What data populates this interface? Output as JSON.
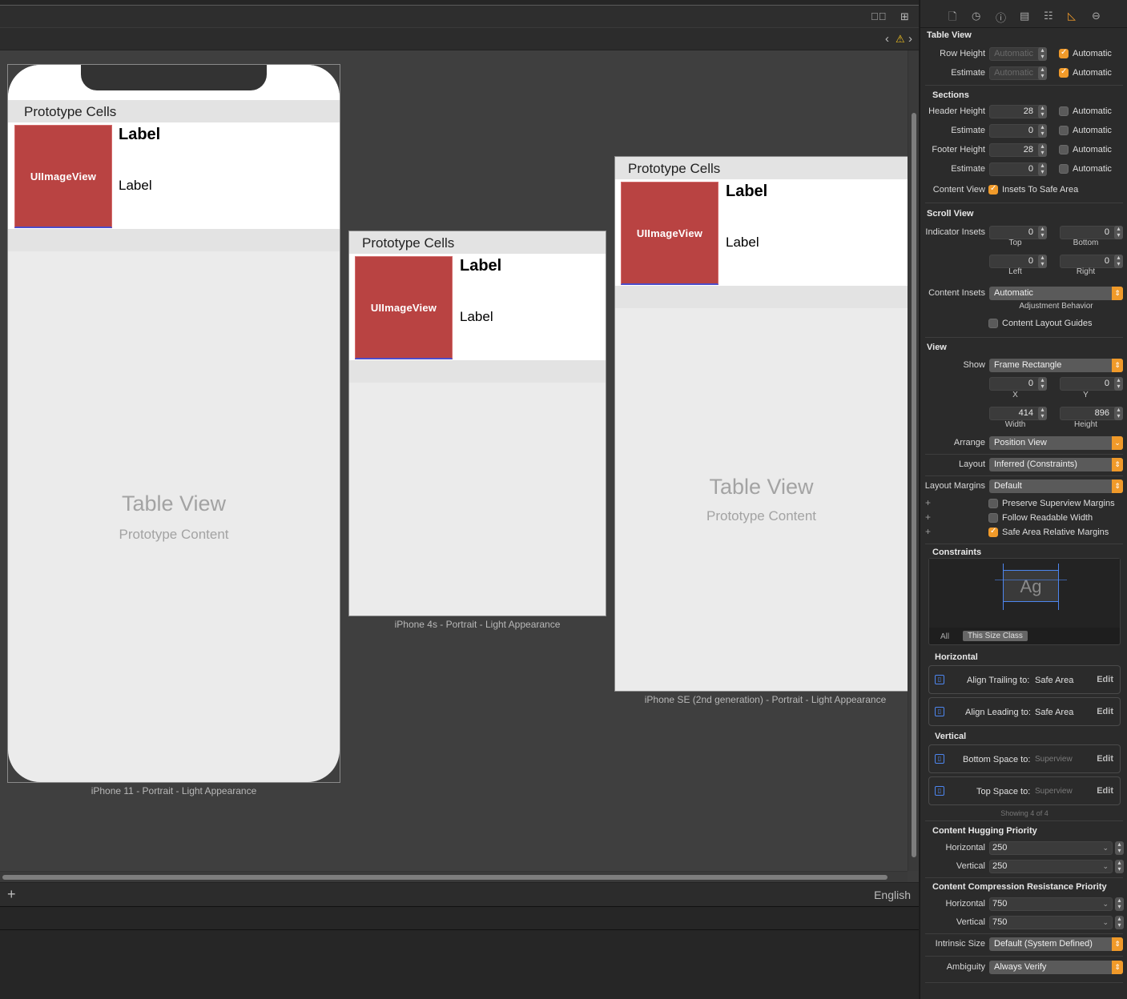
{
  "canvas": {
    "devices": [
      {
        "id": "iphone-11",
        "section_header": "Prototype Cells",
        "image_view_label": "UIImageView",
        "cell_title": "Label",
        "cell_subtitle": "Label",
        "table_title": "Table View",
        "table_subtitle": "Prototype Content",
        "caption": "iPhone 11 - Portrait - Light Appearance"
      },
      {
        "id": "iphone-4s",
        "section_header": "Prototype Cells",
        "image_view_label": "UIImageView",
        "cell_title": "Label",
        "cell_subtitle": "Label",
        "table_title": "",
        "table_subtitle": "",
        "caption": "iPhone 4s - Portrait - Light Appearance"
      },
      {
        "id": "iphone-se",
        "section_header": "Prototype Cells",
        "image_view_label": "UIImageView",
        "cell_title": "Label",
        "cell_subtitle": "Label",
        "table_title": "Table View",
        "table_subtitle": "Prototype Content",
        "caption": "iPhone SE (2nd generation) - Portrait - Light Appearance"
      }
    ],
    "bottom_bar": {
      "add_icon": "plus-icon",
      "language": "English"
    }
  },
  "toolbar_icons": [
    "editor-options-icon",
    "add-editor-icon",
    "back-icon",
    "warning-icon",
    "forward-icon"
  ],
  "inspector": {
    "tabs": [
      "file-icon",
      "history-icon",
      "help-icon",
      "identity-icon",
      "attributes-icon",
      "size-icon",
      "connections-icon"
    ],
    "table_view": {
      "title": "Table View",
      "row_height_label": "Row Height",
      "row_height_value": "Automatic",
      "row_height_auto": "Automatic",
      "estimate_label": "Estimate",
      "estimate_value": "Automatic",
      "estimate_auto": "Automatic"
    },
    "sections": {
      "title": "Sections",
      "header_height_label": "Header Height",
      "header_height_value": "28",
      "header_estimate_label": "Estimate",
      "header_estimate_value": "0",
      "footer_height_label": "Footer Height",
      "footer_height_value": "28",
      "footer_estimate_label": "Estimate",
      "footer_estimate_value": "0",
      "automatic": "Automatic",
      "content_view_label": "Content View",
      "insets_label": "Insets To Safe Area"
    },
    "scroll_view": {
      "title": "Scroll View",
      "indicator_insets_label": "Indicator Insets",
      "top": "0",
      "bottom": "0",
      "left": "0",
      "right": "0",
      "top_label": "Top",
      "bottom_label": "Bottom",
      "left_label": "Left",
      "right_label": "Right",
      "content_insets_label": "Content Insets",
      "content_insets_value": "Automatic",
      "adjustment_label": "Adjustment Behavior",
      "layout_guides_label": "Content Layout Guides"
    },
    "view": {
      "title": "View",
      "show_label": "Show",
      "show_value": "Frame Rectangle",
      "x": "0",
      "y": "0",
      "x_label": "X",
      "y_label": "Y",
      "width": "414",
      "height": "896",
      "width_label": "Width",
      "height_label": "Height",
      "arrange_label": "Arrange",
      "arrange_value": "Position View",
      "layout_label": "Layout",
      "layout_value": "Inferred (Constraints)",
      "margins_label": "Layout Margins",
      "margins_value": "Default",
      "preserve_label": "Preserve Superview Margins",
      "readable_label": "Follow Readable Width",
      "safe_area_label": "Safe Area Relative Margins"
    },
    "constraints": {
      "title": "Constraints",
      "preview_text": "Ag",
      "all_label": "All",
      "size_class_label": "This Size Class",
      "horizontal_title": "Horizontal",
      "vertical_title": "Vertical",
      "rows": [
        {
          "label": "Align Trailing to:",
          "target": "Safe Area",
          "edit": "Edit"
        },
        {
          "label": "Align Leading to:",
          "target": "Safe Area",
          "edit": "Edit"
        },
        {
          "label": "Bottom Space to:",
          "target": "Superview",
          "edit": "Edit"
        },
        {
          "label": "Top Space to:",
          "target": "Superview",
          "edit": "Edit"
        }
      ],
      "showing": "Showing 4 of 4"
    },
    "hugging": {
      "title": "Content Hugging Priority",
      "horizontal_label": "Horizontal",
      "horizontal_value": "250",
      "vertical_label": "Vertical",
      "vertical_value": "250"
    },
    "compression": {
      "title": "Content Compression Resistance Priority",
      "horizontal_label": "Horizontal",
      "horizontal_value": "750",
      "vertical_label": "Vertical",
      "vertical_value": "750"
    },
    "intrinsic_label": "Intrinsic Size",
    "intrinsic_value": "Default (System Defined)",
    "ambiguity_label": "Ambiguity",
    "ambiguity_value": "Always Verify"
  }
}
